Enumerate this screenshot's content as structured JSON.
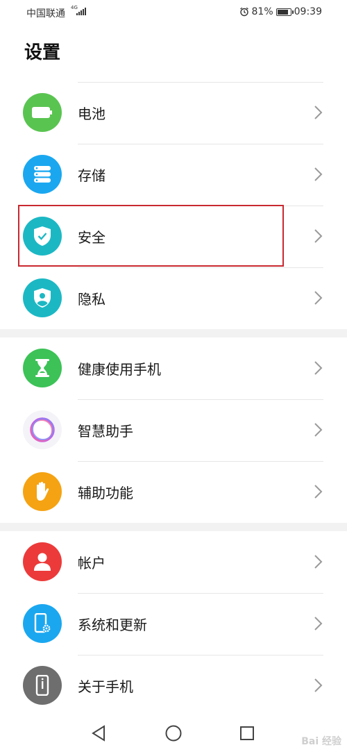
{
  "statusbar": {
    "carrier": "中国联通",
    "network": "4G",
    "battery_percent": "81%",
    "time": "09:39"
  },
  "page_title": "设置",
  "groups": [
    {
      "items": [
        {
          "label": "电池",
          "icon": "battery-icon",
          "color": "#5ac451"
        },
        {
          "label": "存储",
          "icon": "storage-icon",
          "color": "#1aa7f0"
        },
        {
          "label": "安全",
          "icon": "security-shield-icon",
          "color": "#1bb8c4"
        },
        {
          "label": "隐私",
          "icon": "privacy-shield-icon",
          "color": "#1bb8c4"
        }
      ]
    },
    {
      "items": [
        {
          "label": "健康使用手机",
          "icon": "hourglass-icon",
          "color": "#3cc257"
        },
        {
          "label": "智慧助手",
          "icon": "smart-assistant-icon",
          "color": "#ffffff"
        },
        {
          "label": "辅助功能",
          "icon": "hand-icon",
          "color": "#f5a312"
        }
      ]
    },
    {
      "items": [
        {
          "label": "帐户",
          "icon": "account-icon",
          "color": "#ec3a3a"
        },
        {
          "label": "系统和更新",
          "icon": "system-update-icon",
          "color": "#1aa7f0"
        },
        {
          "label": "关于手机",
          "icon": "about-phone-icon",
          "color": "#6e6e6e"
        }
      ]
    }
  ],
  "navbar": {
    "back": "back-icon",
    "home": "home-icon",
    "recents": "recents-icon"
  },
  "watermark": "Bai 经验"
}
